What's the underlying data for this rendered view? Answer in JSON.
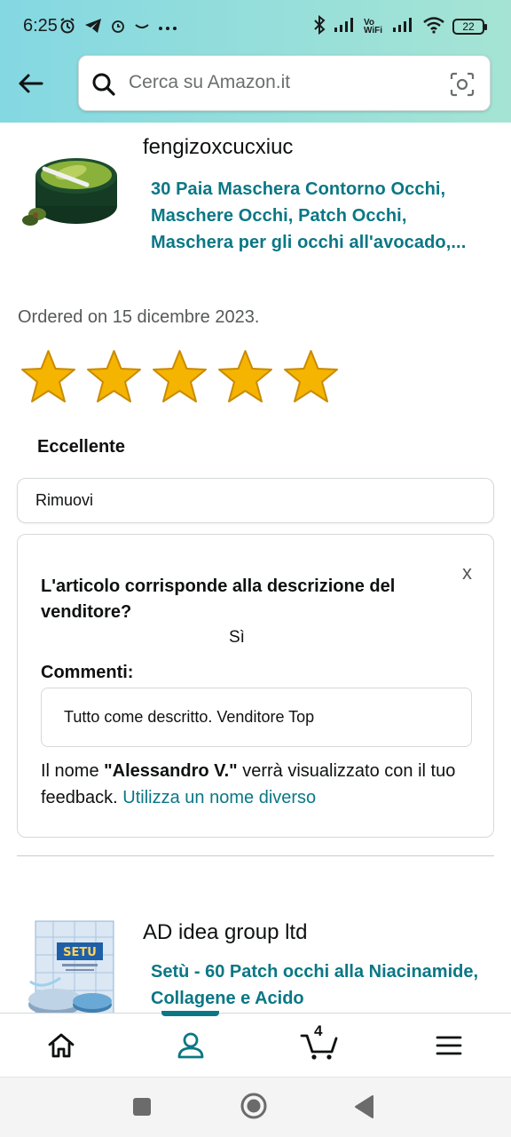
{
  "status_bar": {
    "time": "6:25",
    "vowifi": "Vo WiFi",
    "battery": "22"
  },
  "search": {
    "placeholder": "Cerca su Amazon.it"
  },
  "order1": {
    "seller": "fengizoxcucxiuc",
    "product_title": "30 Paia Maschera Contorno Occhi, Maschere Occhi, Patch Occhi, Maschera per gli occhi all'avocado,...",
    "ordered_on": "Ordered on 15 dicembre 2023.",
    "rating_stars": 5,
    "rating_max": 5,
    "rating_label": "Eccellente",
    "remove_label": "Rimuovi",
    "feedback": {
      "close": "x",
      "question": "L'articolo corrisponde alla descrizione del venditore?",
      "answer": "Sì",
      "comments_label": "Commenti:",
      "comment": "Tutto come descritto. Venditore Top",
      "note_prefix": "Il nome ",
      "name": "\"Alessandro V.\"",
      "note_suffix": " verrà visualizzato con il tuo feedback. ",
      "change_name_link": "Utilizza un nome diverso"
    }
  },
  "order2": {
    "seller": "AD idea group ltd",
    "product_title": "Setù - 60 Patch occhi alla Niacinamide, Collagene e Acido",
    "image_text": "SETU"
  },
  "bottom_nav": {
    "items": [
      "home-icon",
      "account-icon",
      "cart-icon",
      "menu-icon"
    ],
    "cart_count": "4",
    "active": "account"
  },
  "colors": {
    "link": "#0a7785",
    "star": "#f5b400",
    "header_start": "#84d8e2",
    "header_end": "#a5e4d4"
  }
}
